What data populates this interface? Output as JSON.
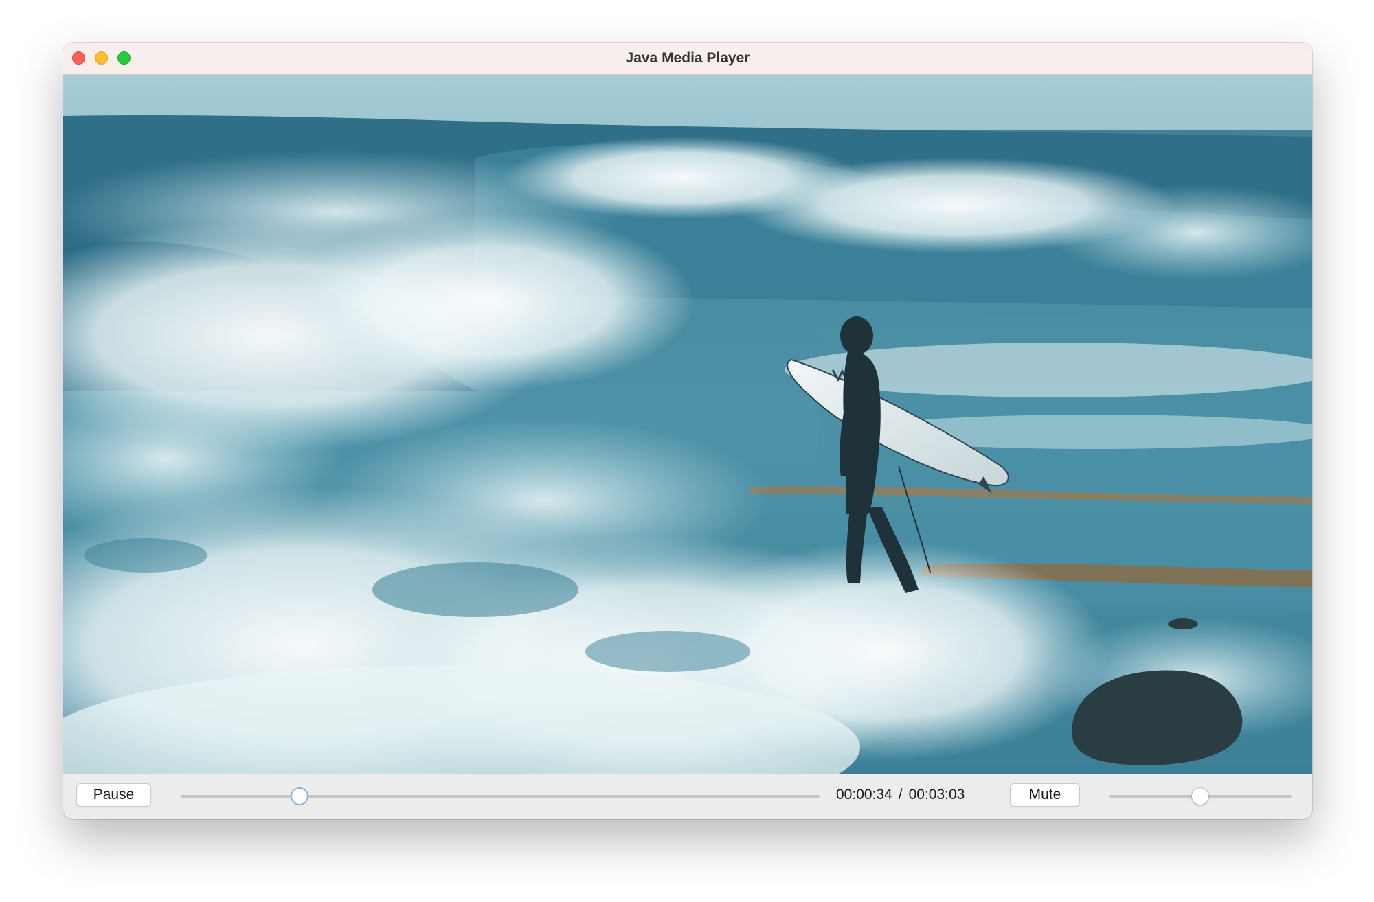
{
  "window": {
    "title": "Java Media Player"
  },
  "video": {
    "description": "Surfer carrying surfboard walking through crashing ocean waves"
  },
  "controls": {
    "pause_label": "Pause",
    "mute_label": "Mute",
    "current_time": "00:00:34",
    "time_separator": "/",
    "total_time": "00:03:03",
    "seek_progress": 0.186,
    "volume_level": 0.5
  },
  "colors": {
    "titlebar": "#f8eeec",
    "close": "#fe5f57",
    "minimize": "#febc2e",
    "maximize": "#28c840",
    "seek_thumb_border": "#8ab3e8"
  },
  "icons": {
    "close": "close-traffic-light",
    "minimize": "minimize-traffic-light",
    "maximize": "maximize-traffic-light"
  }
}
